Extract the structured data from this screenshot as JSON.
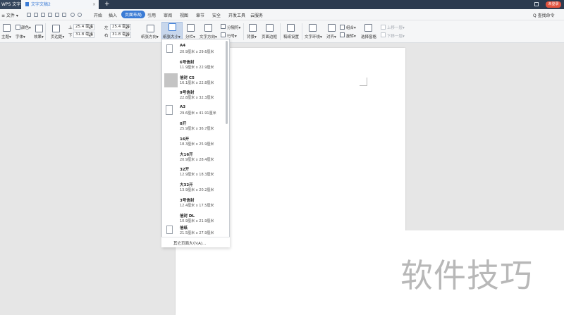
{
  "titlebar": {
    "app_tab": "WPS 文字",
    "doc_tab": "文字文稿2",
    "close": "×",
    "add": "+",
    "login": "未登录"
  },
  "menubar": {
    "file": "≡ 文件 ▾",
    "items": [
      "开始",
      "插入",
      "页面布局",
      "引用",
      "审阅",
      "视图",
      "章节",
      "安全",
      "开发工具",
      "云服务"
    ],
    "active_index": 2,
    "search": "Q 查找命令"
  },
  "ribbon": {
    "theme": "主题▾",
    "colors": "颜色▾",
    "fonts": "字体▾",
    "effects": "效果▾",
    "margins": "页边距▾",
    "top_label": "上",
    "bottom_label": "下",
    "left_label": "左",
    "right_label": "右",
    "top_value": "25.4 毫米",
    "bottom_value": "31.8 毫米",
    "left_value": "25.4 毫米",
    "right_value": "31.8 毫米",
    "orientation": "纸张方向▾",
    "size": "纸张大小▾",
    "columns": "分栏▾",
    "text_direction": "文字方向▾",
    "breaks": "分隔符▾",
    "line_numbers": "行号▾",
    "background": "背景▾",
    "page_border": "页面边框",
    "manuscript": "稿纸设置",
    "text_wrap": "文字环绕▾",
    "align": "对齐▾",
    "group": "组合▾",
    "rotate": "旋转▾",
    "selection_pane": "选择窗格",
    "bring_forward": "上移一层▾",
    "send_backward": "下移一层▾"
  },
  "paper_sizes": [
    {
      "name": "A4",
      "dims": "20.9厘米  x  29.6厘米"
    },
    {
      "name": "6号信封",
      "dims": "11.9厘米  x  22.9厘米"
    },
    {
      "name": "信封 C5",
      "dims": "16.1厘米  x  22.8厘米"
    },
    {
      "name": "9号信封",
      "dims": "22.8厘米  x  32.3厘米"
    },
    {
      "name": "A3",
      "dims": "29.6厘米  x  41.91厘米"
    },
    {
      "name": "8开",
      "dims": "25.9厘米  x  36.7厘米"
    },
    {
      "name": "16开",
      "dims": "18.3厘米  x  25.9厘米"
    },
    {
      "name": "大16开",
      "dims": "20.9厘米  x  28.4厘米"
    },
    {
      "name": "32开",
      "dims": "12.9厘米  x  18.3厘米"
    },
    {
      "name": "大32开",
      "dims": "13.9厘米  x  20.2厘米"
    },
    {
      "name": "3号信封",
      "dims": "12.4厘米  x  17.5厘米"
    },
    {
      "name": "信封 DL",
      "dims": "10.9厘米  x  21.9厘米"
    },
    {
      "name": "信纸",
      "dims": "21.5厘米  x  27.9厘米"
    }
  ],
  "dropdown_footer": "其它页面大小(A)...",
  "watermark": "软件技巧"
}
